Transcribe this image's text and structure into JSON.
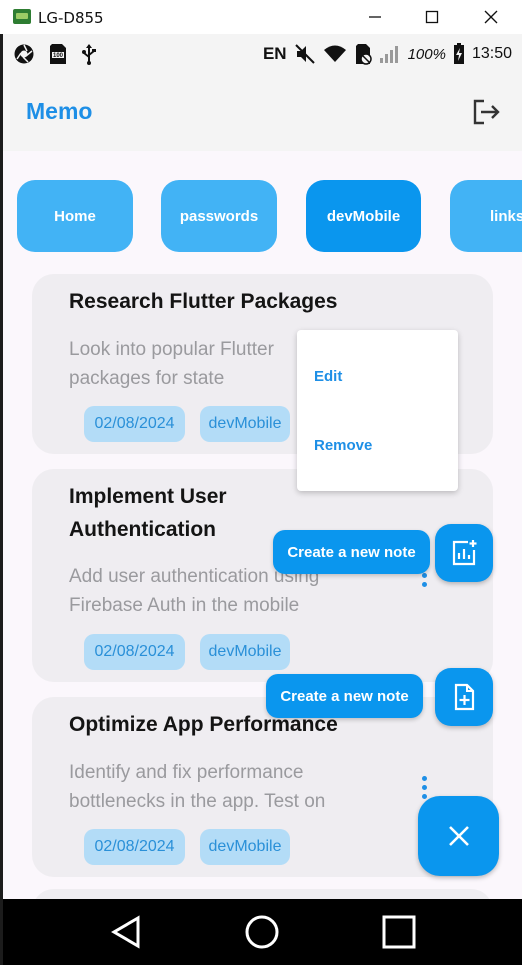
{
  "window": {
    "title": "LG-D855",
    "minimize_glyph": "—",
    "maximize_glyph": "☐",
    "close_glyph": "✕"
  },
  "status_bar": {
    "language": "EN",
    "battery": "100%",
    "time": "13:50",
    "left_icons": [
      "aperture-icon",
      "sd-100-icon",
      "usb-icon"
    ],
    "right_icons": [
      "mute-icon",
      "wifi-icon",
      "no-sim-icon",
      "signal-icon",
      "battery-icon"
    ]
  },
  "app_bar": {
    "title": "Memo",
    "logout_icon": "logout-icon"
  },
  "categories": [
    {
      "label": "Home",
      "active": false
    },
    {
      "label": "passwords",
      "active": false
    },
    {
      "label": "devMobile",
      "active": true
    },
    {
      "label": "links",
      "active": false
    }
  ],
  "notes": [
    {
      "title_lines": [
        "Research Flutter Packages"
      ],
      "body_lines": [
        "Look into popular Flutter",
        "packages for state"
      ],
      "date": "02/08/2024",
      "category": "devMobile"
    },
    {
      "title_lines": [
        "Implement User",
        "Authentication"
      ],
      "body_lines": [
        "Add user authentication using",
        "Firebase Auth in the mobile"
      ],
      "date": "02/08/2024",
      "category": "devMobile"
    },
    {
      "title_lines": [
        "Optimize App Performance"
      ],
      "body_lines": [
        "Identify and fix performance",
        "bottlenecks in the app. Test on"
      ],
      "date": "02/08/2024",
      "category": "devMobile"
    }
  ],
  "context_menu": {
    "items": [
      "Edit",
      "Remove"
    ]
  },
  "fab_menu": {
    "chart_action_label": "Create a new note",
    "file_action_label": "Create a new note",
    "chart_icon": "add-chart-icon",
    "file_icon": "add-file-icon",
    "close_icon": "close-icon"
  },
  "colors": {
    "accent": "#0a96ee",
    "chip": "#42b3f5",
    "brand_text": "#1e8fe6",
    "card": "#efedf1",
    "tag_bg": "#b3dcf7"
  },
  "nav_bar": [
    "back-icon",
    "home-icon",
    "recents-icon"
  ]
}
